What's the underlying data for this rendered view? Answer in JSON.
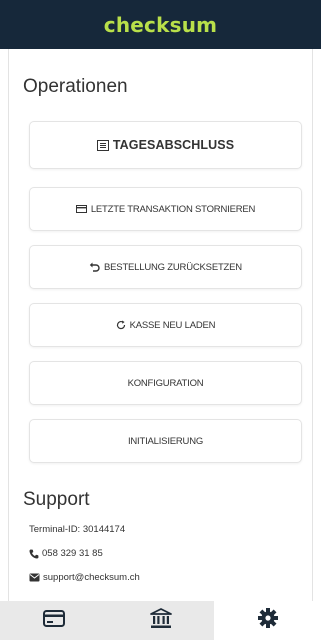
{
  "app": {
    "brand": "checksum",
    "brand_color": "#b9e04a",
    "header_color": "#16283a"
  },
  "operations": {
    "title": "Operationen",
    "buttons": [
      {
        "label": "TAGESABSCHLUSS",
        "icon": "report-icon"
      },
      {
        "label": "LETZTE TRANSAKTION STORNIEREN",
        "icon": "card-icon"
      },
      {
        "label": "BESTELLUNG ZURÜCKSETZEN",
        "icon": "undo-icon"
      },
      {
        "label": "KASSE NEU LADEN",
        "icon": "reload-icon"
      },
      {
        "label": "KONFIGURATION",
        "icon": ""
      },
      {
        "label": "INITIALISIERUNG",
        "icon": ""
      }
    ]
  },
  "support": {
    "title": "Support",
    "terminal_id": "Terminal-ID: 30144174",
    "phone": "058 329 31 85",
    "email": "support@checksum.ch"
  },
  "bottom_nav": [
    {
      "name": "card-icon",
      "active": false
    },
    {
      "name": "bank-icon",
      "active": false
    },
    {
      "name": "settings-gear-icon",
      "active": true
    }
  ]
}
